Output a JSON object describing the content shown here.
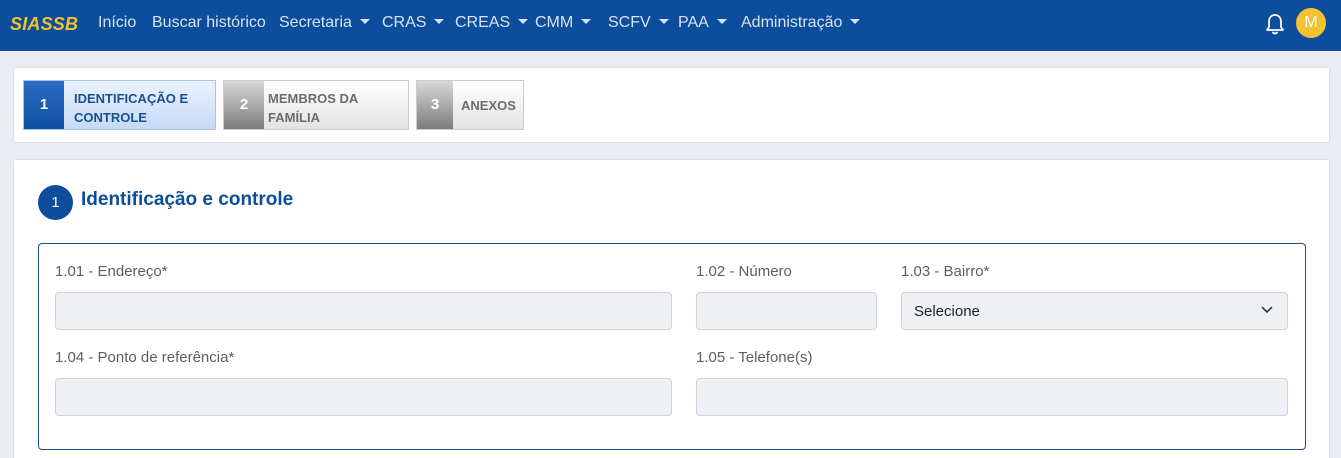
{
  "brand": "SIASSB",
  "nav": {
    "items": [
      {
        "label": "Início",
        "dropdown": false
      },
      {
        "label": "Buscar histórico",
        "dropdown": false
      },
      {
        "label": "Secretaria",
        "dropdown": true
      },
      {
        "label": "CRAS",
        "dropdown": true
      },
      {
        "label": "CREAS",
        "dropdown": true
      },
      {
        "label": "CMM",
        "dropdown": true
      },
      {
        "label": "SCFV",
        "dropdown": true
      },
      {
        "label": "PAA",
        "dropdown": true
      },
      {
        "label": "Administração",
        "dropdown": true
      }
    ],
    "avatar_initial": "M"
  },
  "steps": [
    {
      "number": "1",
      "label_line1": "IDENTIFICAÇÃO E",
      "label_line2": "CONTROLE",
      "active": true
    },
    {
      "number": "2",
      "label_line1": "MEMBROS DA",
      "label_line2": "FAMÍLIA",
      "active": false
    },
    {
      "number": "3",
      "label_line1": "ANEXOS",
      "label_line2": "",
      "active": false
    }
  ],
  "section": {
    "number": "1",
    "title": "Identificação e controle"
  },
  "fields": {
    "endereco": {
      "label": "1.01 - Endereço*",
      "value": "",
      "placeholder": ""
    },
    "numero": {
      "label": "1.02 - Número",
      "value": "",
      "placeholder": ""
    },
    "bairro": {
      "label": "1.03 - Bairro*",
      "selected": "Selecione"
    },
    "ponto_referencia": {
      "label": "1.04 - Ponto de referência*",
      "value": "",
      "placeholder": ""
    },
    "telefones": {
      "label": "1.05 - Telefone(s)",
      "value": "",
      "placeholder": ""
    }
  },
  "colors": {
    "navbar": "#0c4d9c",
    "brand": "#f2c230",
    "accent": "#0c4d9c"
  },
  "icons": {
    "bell": "bell-icon",
    "bairro_select": "chevron-down-icon"
  }
}
